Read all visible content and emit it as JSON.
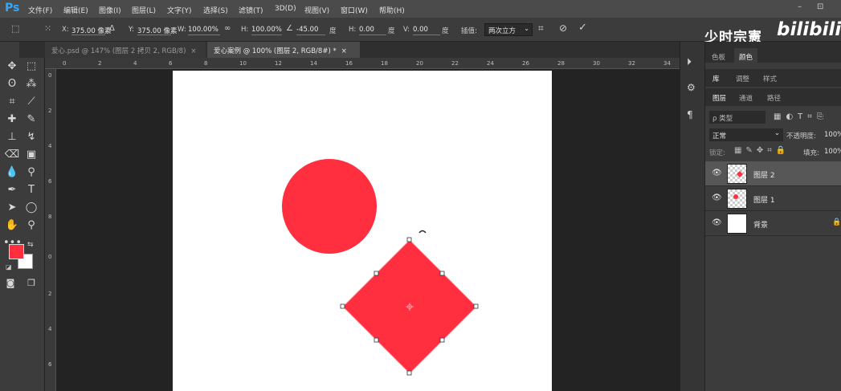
{
  "app": {
    "logo": "Ps"
  },
  "menu": [
    "文件(F)",
    "编辑(E)",
    "图像(I)",
    "图层(L)",
    "文字(Y)",
    "选择(S)",
    "滤镜(T)",
    "3D(D)",
    "视图(V)",
    "窗口(W)",
    "帮助(H)"
  ],
  "window_controls": {
    "minimize": "–",
    "maximize": "⊡"
  },
  "options": {
    "x_label": "X:",
    "x_value": "375.00 像素",
    "y_label": "Y:",
    "y_value": "375.00 像素",
    "w_label": "W:",
    "w_value": "100.00%",
    "h_label": "H:",
    "h_value": "100.00%",
    "angle_value": "-45.00",
    "angle_unit": "度",
    "hskew_label": "H:",
    "hskew_value": "0.00",
    "hskew_unit": "度",
    "vskew_label": "V:",
    "vskew_value": "0.00",
    "vskew_unit": "度",
    "interp_label": "插值:",
    "interp_value": "两次立方"
  },
  "watermark": {
    "text": "少时宗憲",
    "logo": "bilibili"
  },
  "tabs": [
    {
      "label": "爱心.psd @ 147% (图层 2 拷贝 2, RGB/8)",
      "close": "×"
    },
    {
      "label": "爱心案例 @ 100% (图层 2, RGB/8#) *",
      "close": "×"
    }
  ],
  "rulers": {
    "top": [
      "0",
      "2",
      "4",
      "6",
      "8",
      "10",
      "12",
      "14",
      "16",
      "18",
      "20",
      "22",
      "24",
      "26",
      "28",
      "30",
      "32",
      "34"
    ],
    "left": [
      "0",
      "2",
      "4",
      "6",
      "8",
      "0",
      "2",
      "4",
      "6"
    ]
  },
  "panels": {
    "color_tabs": [
      "色板",
      "颜色"
    ],
    "library_tabs": [
      "库",
      "调整",
      "样式"
    ],
    "layer_tabs": [
      "图层",
      "通道",
      "路径"
    ],
    "filter_kind": "ρ 类型",
    "blend_mode": "正常",
    "opacity_label": "不透明度:",
    "opacity_value": "100%",
    "lock_label": "锁定:",
    "fill_label": "填充:",
    "fill_value": "100%"
  },
  "layers": [
    {
      "name": "图层 2",
      "selected": true
    },
    {
      "name": "图层 1",
      "selected": false
    },
    {
      "name": "背景",
      "selected": false,
      "locked": true
    }
  ],
  "colors": {
    "shape_red": "#ff2f3f",
    "foreground": "#ff2f3f",
    "background": "#ffffff"
  }
}
